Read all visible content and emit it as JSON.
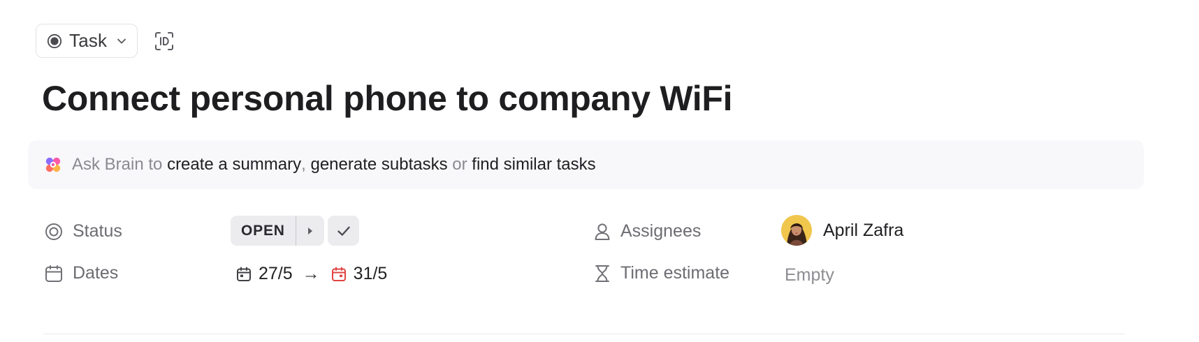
{
  "header": {
    "task_type_label": "Task",
    "task_type_icon": "radio-dot-icon",
    "id_button_icon": "id-icon"
  },
  "task": {
    "title": "Connect personal phone to company WiFi"
  },
  "brain_bar": {
    "prefix": "Ask Brain to",
    "link_1": "create a summary",
    "separator": ",",
    "link_2": "generate subtasks",
    "conjunction": "or",
    "link_3": "find similar tasks"
  },
  "fields": {
    "status": {
      "label": "Status",
      "value": "OPEN"
    },
    "dates": {
      "label": "Dates",
      "start": "27/5",
      "arrow": "→",
      "due": "31/5"
    },
    "assignees": {
      "label": "Assignees",
      "name": "April Zafra"
    },
    "time_estimate": {
      "label": "Time estimate",
      "value": "Empty"
    }
  },
  "colors": {
    "brain_bar_bg": "#f8f7fa",
    "status_pill_bg": "#ececef",
    "due_date_red": "#e04343",
    "muted_text": "#8a8a90"
  }
}
